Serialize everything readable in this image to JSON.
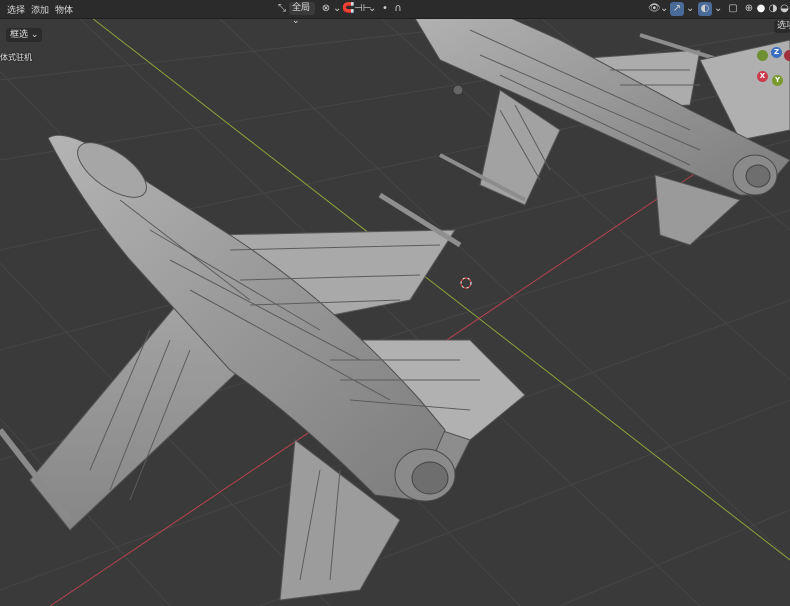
{
  "menu": {
    "select": "选择",
    "add": "添加",
    "object": "物体"
  },
  "header": {
    "transform_orientation": "全局",
    "snap_icon": "snap-icon",
    "proportional_icon": "proportional-edit-icon"
  },
  "selection_mode": "框选",
  "object_name": "体式驻机",
  "right_panel_tab": "选项",
  "gizmo": {
    "z": "Z",
    "x": "X",
    "y": "Y"
  },
  "colors": {
    "header_bg": "#2b2b2b",
    "grid_bg": "#3a3a3a",
    "x_axis": "#b8424f",
    "y_axis": "#8aa33a",
    "model": "#9a9a9a"
  }
}
